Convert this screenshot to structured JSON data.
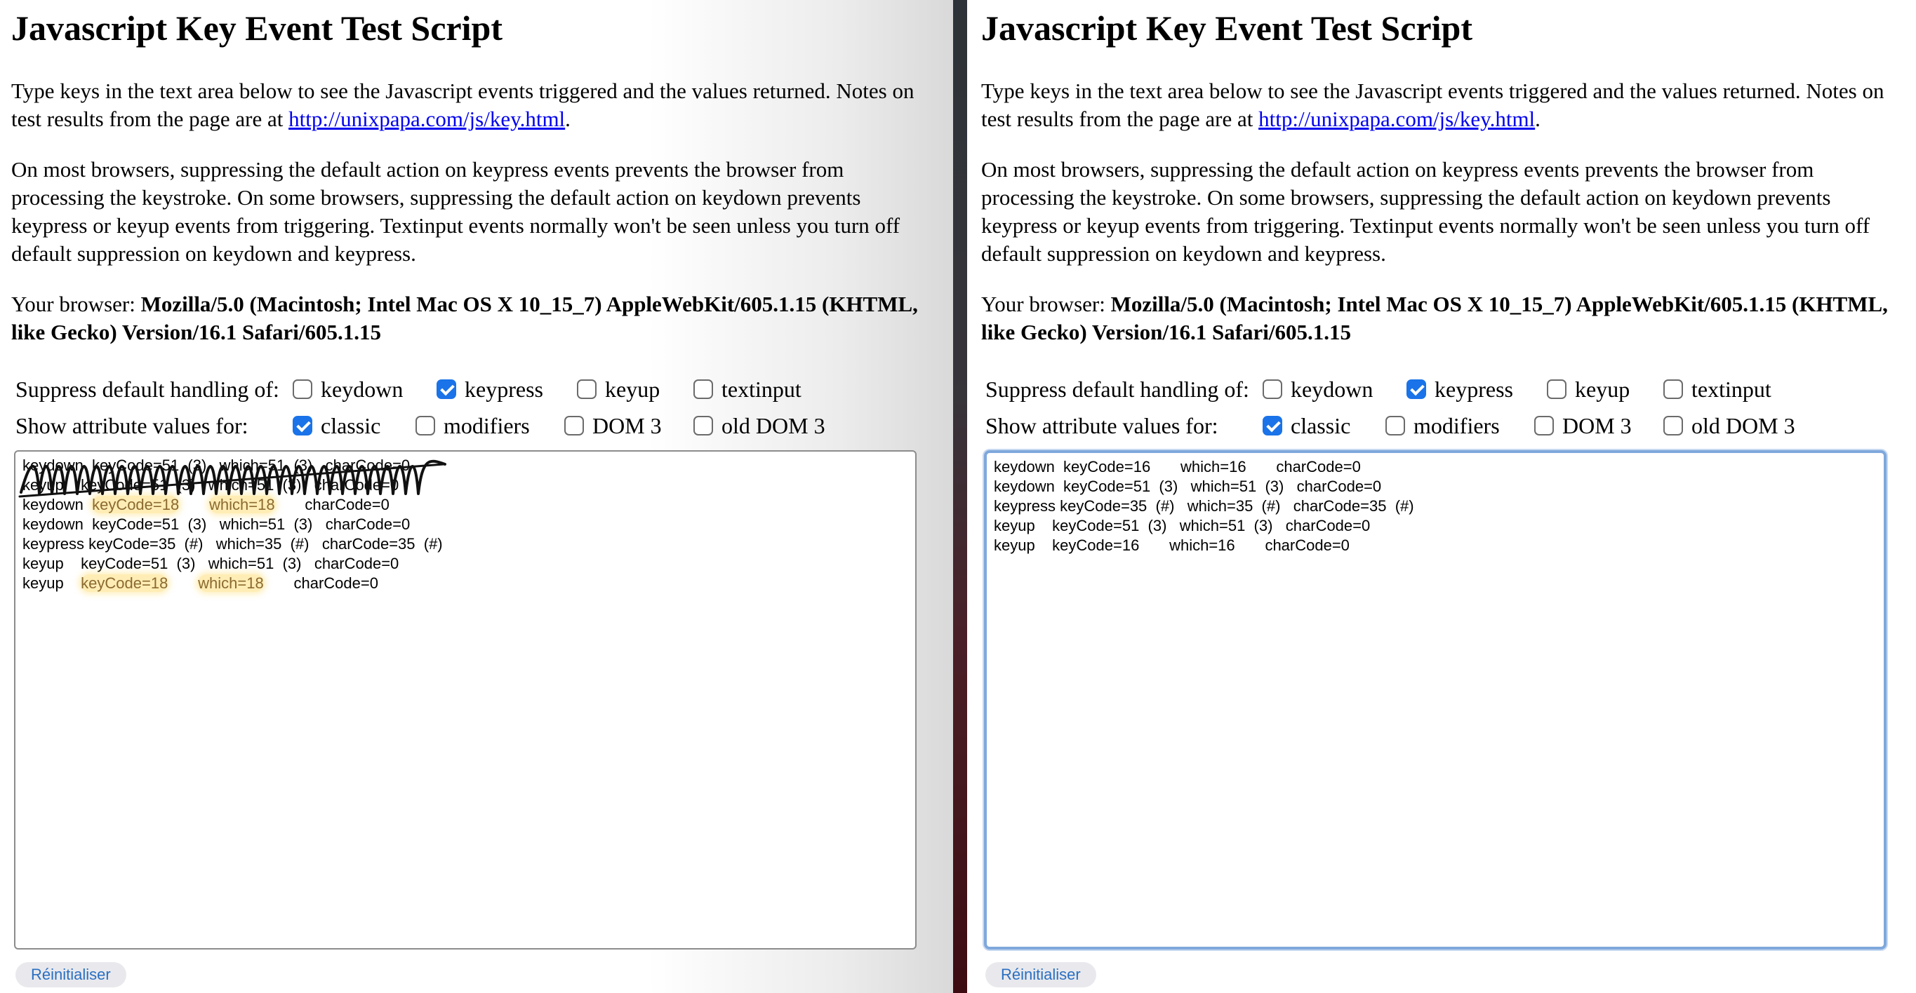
{
  "title": "Javascript Key Event Test Script",
  "intro_text": "Type keys in the text area below to see the Javascript events triggered and the values returned. Notes on test results from the page are at ",
  "notes_link": "http://unixpapa.com/js/key.html",
  "intro_end": ".",
  "suppress_text": "On most browsers, suppressing the default action on keypress events prevents the browser from processing the keystroke. On some browsers, suppressing the default action on keydown prevents keypress or keyup events from triggering. Textinput events normally won't be seen unless you turn off default suppression on keydown and keypress.",
  "browser_label": "Your browser: ",
  "user_agent": "Mozilla/5.0 (Macintosh; Intel Mac OS X 10_15_7) AppleWebKit/605.1.15 (KHTML, like Gecko) Version/16.1 Safari/605.1.15",
  "suppress_label": "Suppress default handling of:",
  "suppress_options": [
    {
      "label": "keydown",
      "checked": false
    },
    {
      "label": "keypress",
      "checked": true
    },
    {
      "label": "keyup",
      "checked": false
    },
    {
      "label": "textinput",
      "checked": false
    }
  ],
  "show_label": "Show attribute values for:",
  "show_options": [
    {
      "label": "classic",
      "checked": true
    },
    {
      "label": "modifiers",
      "checked": false
    },
    {
      "label": "DOM 3",
      "checked": false
    },
    {
      "label": "old DOM 3",
      "checked": false
    }
  ],
  "reset_label": "Réinitialiser",
  "left_log": {
    "scribbled_lines": [
      "keydown  keyCode=51  (3)   which=51  (3)   charCode=0",
      "keyup    keyCode=51  (3)   which=51  (3)   charCode=0"
    ],
    "lines": [
      {
        "event": "keydown ",
        "keycode": "keyCode=18",
        "gap1": "       ",
        "which": "which=18",
        "gap2": "       ",
        "charcode": "charCode=0",
        "highlight": true
      },
      {
        "event": "keydown ",
        "keycode": "keyCode=51  (3)",
        "gap1": "   ",
        "which": "which=51  (3)",
        "gap2": "   ",
        "charcode": "charCode=0",
        "highlight": false
      },
      {
        "event": "keypress",
        "keycode": "keyCode=35  (#)",
        "gap1": "   ",
        "which": "which=35  (#)",
        "gap2": "   ",
        "charcode": "charCode=35  (#)",
        "highlight": false
      },
      {
        "event": "keyup   ",
        "keycode": "keyCode=51  (3)",
        "gap1": "   ",
        "which": "which=51  (3)",
        "gap2": "   ",
        "charcode": "charCode=0",
        "highlight": false
      },
      {
        "event": "keyup   ",
        "keycode": "keyCode=18",
        "gap1": "       ",
        "which": "which=18",
        "gap2": "       ",
        "charcode": "charCode=0",
        "highlight": true
      }
    ]
  },
  "right_log": {
    "lines": [
      "keydown  keyCode=16       which=16       charCode=0",
      "keydown  keyCode=51  (3)   which=51  (3)   charCode=0",
      "keypress keyCode=35  (#)   which=35  (#)   charCode=35  (#)",
      "keyup    keyCode=51  (3)   which=51  (3)   charCode=0",
      "keyup    keyCode=16       which=16       charCode=0"
    ]
  }
}
